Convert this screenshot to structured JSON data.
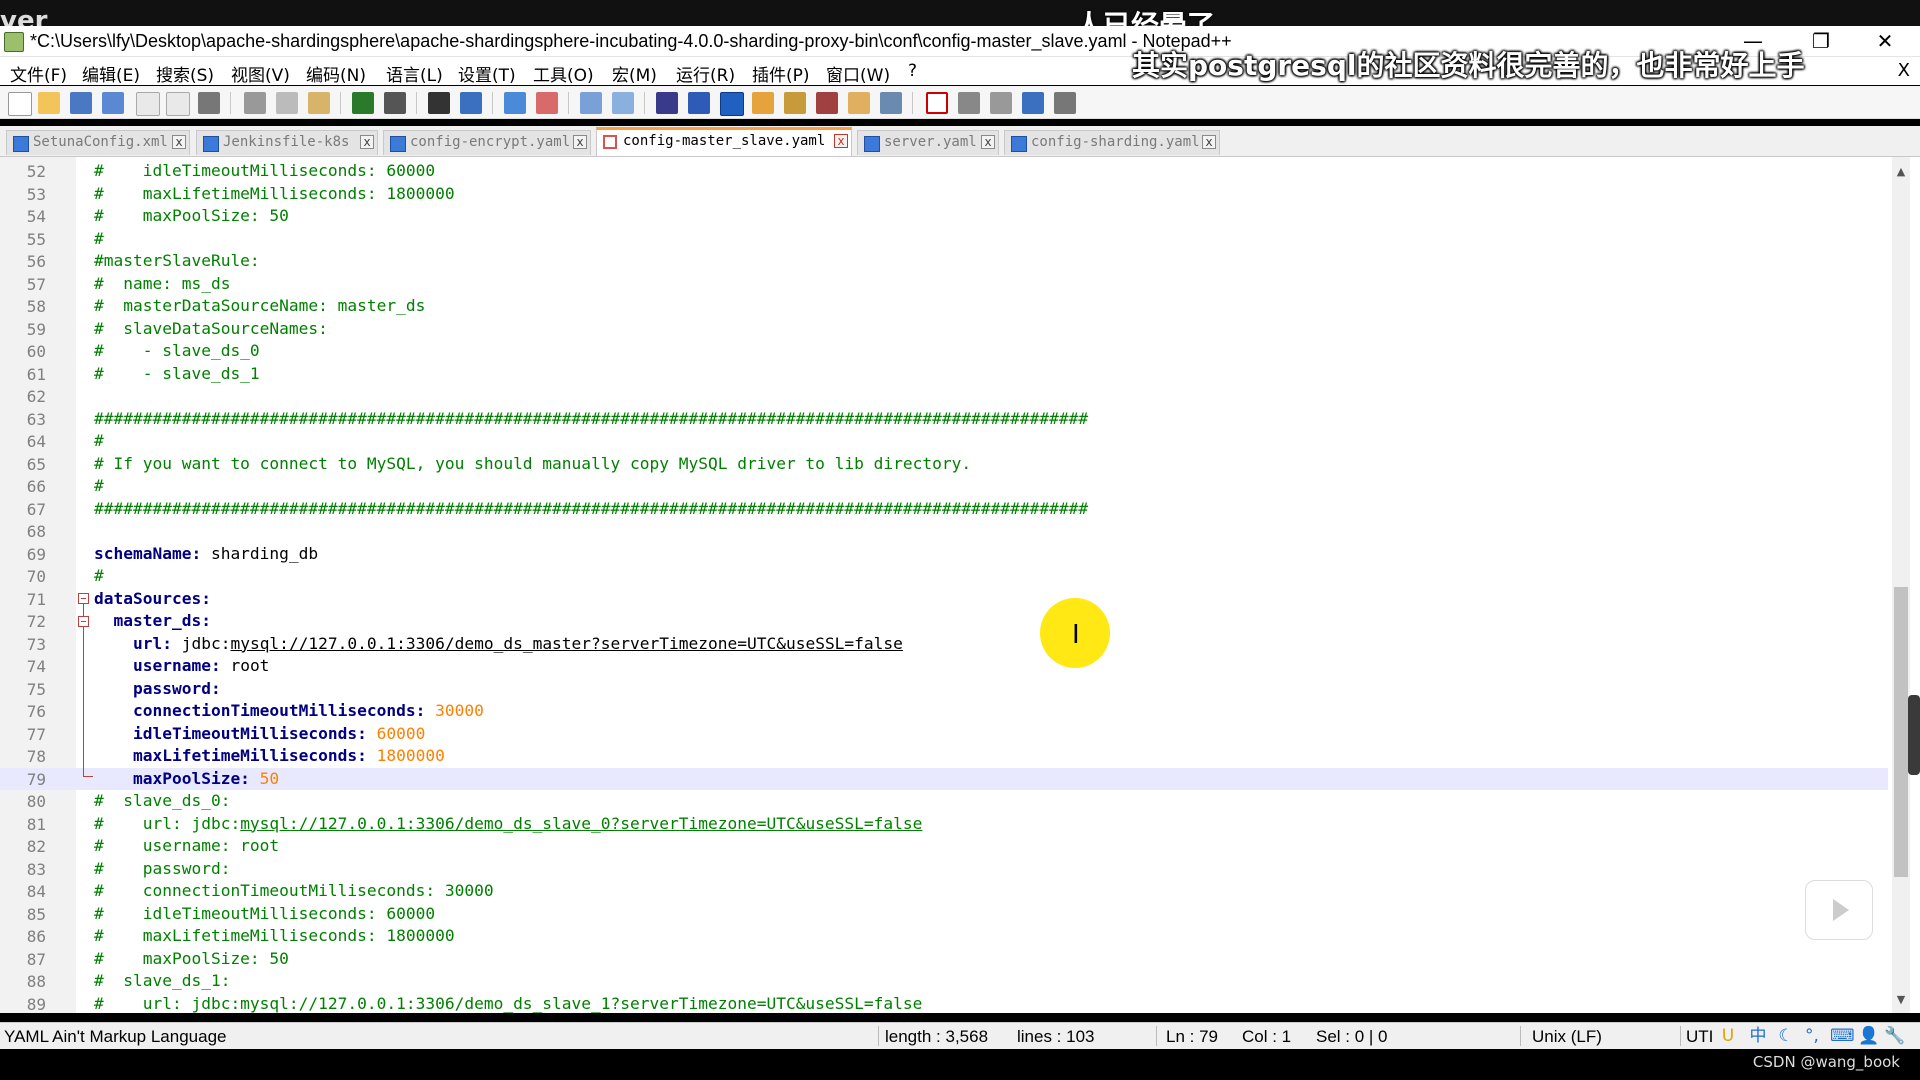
{
  "window": {
    "title": "*C:\\Users\\lfy\\Desktop\\apache-shardingsphere\\apache-shardingsphere-incubating-4.0.0-sharding-proxy-bin\\conf\\config-master_slave.yaml - Notepad++",
    "minimize": "—",
    "restore": "❐",
    "close": "✕"
  },
  "overlay": {
    "top_left": "ver",
    "top_caption": "人已经晕了",
    "sub_caption": "其实postgresql的社区资料很完善的，也非常好上手"
  },
  "menu": [
    {
      "label": "文件(F)"
    },
    {
      "label": "编辑(E)"
    },
    {
      "label": "搜索(S)"
    },
    {
      "label": "视图(V)"
    },
    {
      "label": "编码(N)"
    },
    {
      "label": "语言(L)"
    },
    {
      "label": "设置(T)"
    },
    {
      "label": "工具(O)"
    },
    {
      "label": "宏(M)"
    },
    {
      "label": "运行(R)"
    },
    {
      "label": "插件(P)"
    },
    {
      "label": "窗口(W)"
    },
    {
      "label": "?"
    }
  ],
  "menu_close": "X",
  "tabs": [
    {
      "label": "SetunaConfig.xml",
      "active": false
    },
    {
      "label": "Jenkinsfile-k8s",
      "active": false
    },
    {
      "label": "config-encrypt.yaml",
      "active": false
    },
    {
      "label": "config-master_slave.yaml",
      "active": true
    },
    {
      "label": "server.yaml",
      "active": false
    },
    {
      "label": "config-sharding.yaml",
      "active": false
    }
  ],
  "tab_close": "x",
  "editor": {
    "current_line": 79,
    "lines": [
      {
        "n": "52",
        "text": "#    idleTimeoutMilliseconds: 60000"
      },
      {
        "n": "53",
        "text": "#    maxLifetimeMilliseconds: 1800000"
      },
      {
        "n": "54",
        "text": "#    maxPoolSize: 50"
      },
      {
        "n": "55",
        "text": "#"
      },
      {
        "n": "56",
        "text": "#masterSlaveRule:"
      },
      {
        "n": "57",
        "text": "#  name: ms_ds"
      },
      {
        "n": "58",
        "text": "#  masterDataSourceName: master_ds"
      },
      {
        "n": "59",
        "text": "#  slaveDataSourceNames:"
      },
      {
        "n": "60",
        "text": "#    - slave_ds_0"
      },
      {
        "n": "61",
        "text": "#    - slave_ds_1"
      },
      {
        "n": "62",
        "text": ""
      },
      {
        "n": "63",
        "text": "######################################################################################################"
      },
      {
        "n": "64",
        "text": "#"
      },
      {
        "n": "65",
        "text": "# If you want to connect to MySQL, you should manually copy MySQL driver to lib directory."
      },
      {
        "n": "66",
        "text": "#"
      },
      {
        "n": "67",
        "text": "######################################################################################################"
      },
      {
        "n": "68",
        "text": ""
      },
      {
        "n": "69",
        "key": "schemaName:",
        "val": " sharding_db"
      },
      {
        "n": "70",
        "text": "#"
      },
      {
        "n": "71",
        "key": "dataSources:",
        "val": ""
      },
      {
        "n": "72",
        "key": "  master_ds:",
        "val": ""
      },
      {
        "n": "73",
        "key": "    url:",
        "val": " jdbc:",
        "link": "mysql://127.0.0.1:3306/demo_ds_master?serverTimezone=UTC&useSSL=false"
      },
      {
        "n": "74",
        "key": "    username:",
        "val": " root"
      },
      {
        "n": "75",
        "key": "    password:",
        "val": ""
      },
      {
        "n": "76",
        "key": "    connectionTimeoutMilliseconds:",
        "num": " 30000"
      },
      {
        "n": "77",
        "key": "    idleTimeoutMilliseconds:",
        "num": " 60000"
      },
      {
        "n": "78",
        "key": "    maxLifetimeMilliseconds:",
        "num": " 1800000"
      },
      {
        "n": "79",
        "key": "    maxPoolSize:",
        "num": " 50"
      },
      {
        "n": "80",
        "text": "#  slave_ds_0:"
      },
      {
        "n": "81",
        "text": "#    url: jdbc:",
        "clink": "mysql://127.0.0.1:3306/demo_ds_slave_0?serverTimezone=UTC&useSSL=false"
      },
      {
        "n": "82",
        "text": "#    username: root"
      },
      {
        "n": "83",
        "text": "#    password:"
      },
      {
        "n": "84",
        "text": "#    connectionTimeoutMilliseconds: 30000"
      },
      {
        "n": "85",
        "text": "#    idleTimeoutMilliseconds: 60000"
      },
      {
        "n": "86",
        "text": "#    maxLifetimeMilliseconds: 1800000"
      },
      {
        "n": "87",
        "text": "#    maxPoolSize: 50"
      },
      {
        "n": "88",
        "text": "#  slave_ds_1:"
      },
      {
        "n": "89",
        "text": "#    url: jdbc:mysql://127.0.0.1:3306/demo_ds_slave_1?serverTimezone=UTC&useSSL=false"
      }
    ]
  },
  "status": {
    "language": "YAML Ain't Markup Language",
    "length": "length : 3,568",
    "lines": "lines : 103",
    "ln": "Ln : 79",
    "col": "Col : 1",
    "sel": "Sel : 0 | 0",
    "eol": "Unix (LF)",
    "encoding": "UTI"
  },
  "tray": [
    "U",
    "中",
    "☾",
    "°,",
    "⌨",
    "👤",
    "🔧"
  ],
  "watermark": "CSDN @wang_book",
  "colors": {
    "comment": "#008000",
    "key": "#000080",
    "number": "#ff8000",
    "active_tab_accent": "#f9a13f",
    "cursor_highlight": "#ffe600"
  }
}
